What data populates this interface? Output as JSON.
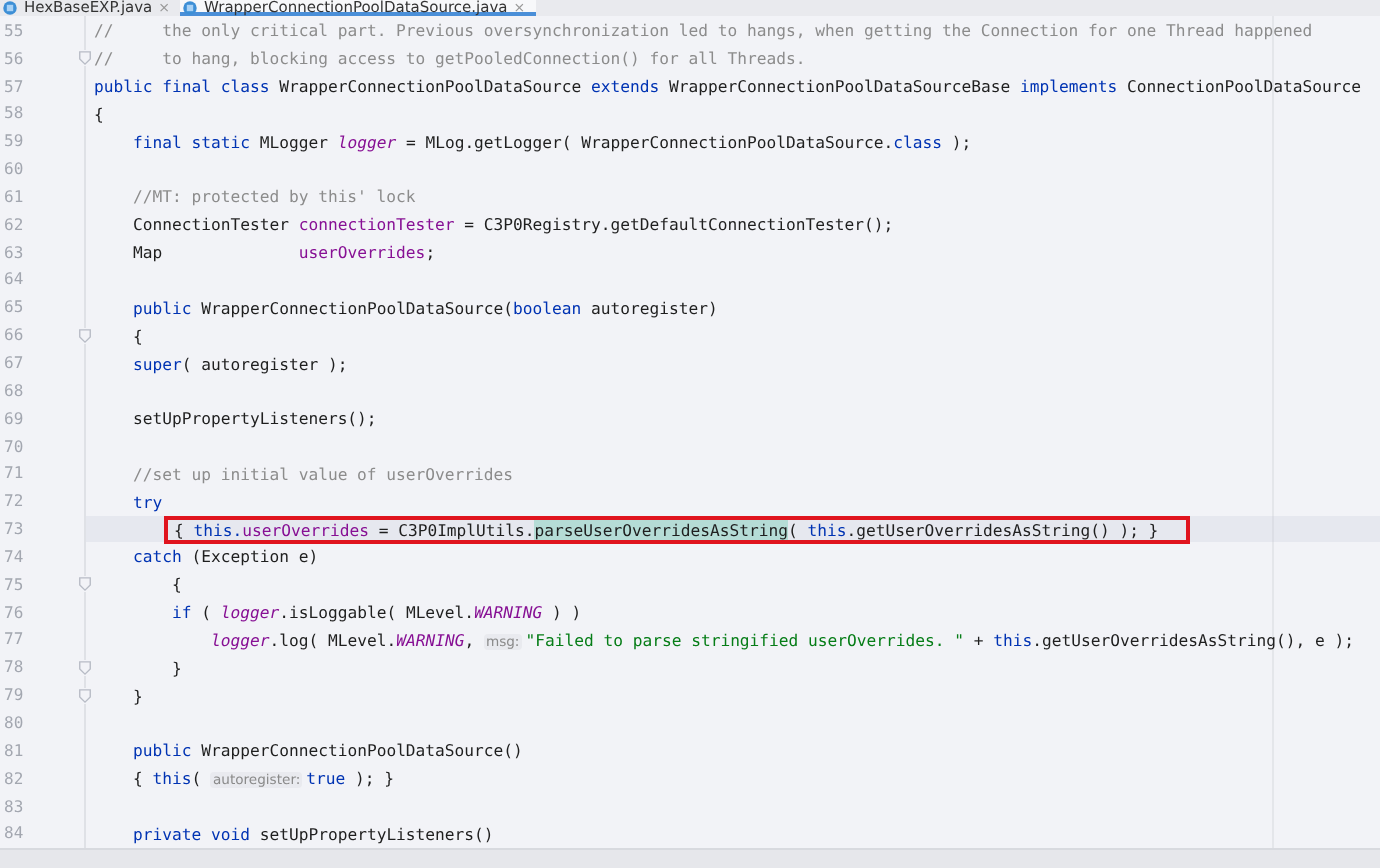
{
  "tabs": [
    {
      "label": "HexBaseEXP.java",
      "close": "×",
      "selected": false
    },
    {
      "label": "WrapperConnectionPoolDataSource.java",
      "close": "×",
      "selected": true
    }
  ],
  "lines": [
    {
      "number": "55",
      "tokens": [
        {
          "kind": "comment",
          "t": "//     the only critical part. Previous oversynchronization led to hangs, when getting the Connection for one Thread happened"
        }
      ]
    },
    {
      "number": "56",
      "fold": true,
      "tokens": [
        {
          "kind": "comment",
          "t": "//     to hang, blocking access to getPooledConnection() for all Threads."
        }
      ]
    },
    {
      "number": "57",
      "tokens": [
        {
          "kind": "keyword",
          "t": "public final class"
        },
        {
          "kind": "plain",
          "t": " WrapperConnectionPoolDataSource "
        },
        {
          "kind": "keyword",
          "t": "extends"
        },
        {
          "kind": "plain",
          "t": " WrapperConnectionPoolDataSourceBase "
        },
        {
          "kind": "keyword",
          "t": "implements"
        },
        {
          "kind": "plain",
          "t": " ConnectionPoolDataSource"
        }
      ]
    },
    {
      "number": "58",
      "tokens": [
        {
          "kind": "plain",
          "t": "{"
        }
      ]
    },
    {
      "number": "59",
      "tokens": [
        {
          "kind": "keyword",
          "t": "    final static"
        },
        {
          "kind": "plain",
          "t": " MLogger "
        },
        {
          "kind": "static",
          "t": "logger"
        },
        {
          "kind": "plain",
          "t": " = MLog.getLogger( WrapperConnectionPoolDataSource."
        },
        {
          "kind": "keyword",
          "t": "class"
        },
        {
          "kind": "plain",
          "t": " );"
        }
      ]
    },
    {
      "number": "60"
    },
    {
      "number": "61",
      "tokens": [
        {
          "kind": "comment",
          "t": "    //MT: protected by this' lock"
        }
      ]
    },
    {
      "number": "62",
      "tokens": [
        {
          "kind": "plain",
          "t": "    ConnectionTester "
        },
        {
          "kind": "field",
          "t": "connectionTester"
        },
        {
          "kind": "plain",
          "t": " = C3P0Registry.getDefaultConnectionTester();"
        }
      ]
    },
    {
      "number": "63",
      "tokens": [
        {
          "kind": "plain",
          "t": "    Map              "
        },
        {
          "kind": "field",
          "t": "userOverrides"
        },
        {
          "kind": "plain",
          "t": ";"
        }
      ]
    },
    {
      "number": "64"
    },
    {
      "number": "65",
      "tokens": [
        {
          "kind": "keyword",
          "t": "    public"
        },
        {
          "kind": "plain",
          "t": " WrapperConnectionPoolDataSource("
        },
        {
          "kind": "keyword",
          "t": "boolean"
        },
        {
          "kind": "plain",
          "t": " autoregister)"
        }
      ]
    },
    {
      "number": "66",
      "fold": true,
      "tokens": [
        {
          "kind": "plain",
          "t": "    {"
        }
      ]
    },
    {
      "number": "67",
      "tokens": [
        {
          "kind": "keyword",
          "t": "    super"
        },
        {
          "kind": "plain",
          "t": "( autoregister );"
        }
      ]
    },
    {
      "number": "68"
    },
    {
      "number": "69",
      "tokens": [
        {
          "kind": "plain",
          "t": "    setUpPropertyListeners();"
        }
      ]
    },
    {
      "number": "70"
    },
    {
      "number": "71",
      "tokens": [
        {
          "kind": "comment",
          "t": "    //set up initial value of userOverrides"
        }
      ]
    },
    {
      "number": "72",
      "tokens": [
        {
          "kind": "keyword",
          "t": "    try"
        }
      ]
    },
    {
      "number": "73",
      "current": true,
      "boxed": true,
      "tokens": [
        {
          "kind": "plain",
          "t": "        { "
        },
        {
          "kind": "keyword",
          "t": "this."
        },
        {
          "kind": "field",
          "t": "userOverrides"
        },
        {
          "kind": "plain",
          "t": " = C3P0ImplUtils."
        },
        {
          "kind": "match",
          "t": "parseUserOverridesAsString"
        },
        {
          "kind": "plain",
          "t": "( "
        },
        {
          "kind": "keyword",
          "t": "this"
        },
        {
          "kind": "plain",
          "t": ".getUserOverridesAsString() ); }"
        }
      ]
    },
    {
      "number": "74",
      "tokens": [
        {
          "kind": "keyword",
          "t": "    catch"
        },
        {
          "kind": "plain",
          "t": " (Exception e)"
        }
      ]
    },
    {
      "number": "75",
      "fold": true,
      "tokens": [
        {
          "kind": "plain",
          "t": "        {"
        }
      ]
    },
    {
      "number": "76",
      "tokens": [
        {
          "kind": "keyword",
          "t": "        if"
        },
        {
          "kind": "plain",
          "t": " ( "
        },
        {
          "kind": "static",
          "t": "logger"
        },
        {
          "kind": "plain",
          "t": ".isLoggable( MLevel."
        },
        {
          "kind": "static",
          "t": "WARNING"
        },
        {
          "kind": "plain",
          "t": " ) )"
        }
      ]
    },
    {
      "number": "77",
      "tokens": [
        {
          "kind": "static",
          "t": "            logger"
        },
        {
          "kind": "plain",
          "t": ".log( MLevel."
        },
        {
          "kind": "static",
          "t": "WARNING"
        },
        {
          "kind": "plain",
          "t": ", "
        },
        {
          "kind": "hint",
          "t": "msg:"
        },
        {
          "kind": "string",
          "t": "\"Failed to parse stringified userOverrides. \""
        },
        {
          "kind": "plain",
          "t": " + "
        },
        {
          "kind": "keyword",
          "t": "this"
        },
        {
          "kind": "plain",
          "t": ".getUserOverridesAsString(), e );"
        }
      ]
    },
    {
      "number": "78",
      "fold": true,
      "tokens": [
        {
          "kind": "plain",
          "t": "        }"
        }
      ]
    },
    {
      "number": "79",
      "fold": true,
      "tokens": [
        {
          "kind": "plain",
          "t": "    }"
        }
      ]
    },
    {
      "number": "80"
    },
    {
      "number": "81",
      "tokens": [
        {
          "kind": "keyword",
          "t": "    public"
        },
        {
          "kind": "plain",
          "t": " WrapperConnectionPoolDataSource()"
        }
      ]
    },
    {
      "number": "82",
      "tokens": [
        {
          "kind": "plain",
          "t": "    { "
        },
        {
          "kind": "keyword",
          "t": "this"
        },
        {
          "kind": "plain",
          "t": "( "
        },
        {
          "kind": "hint",
          "t": "autoregister:"
        },
        {
          "kind": "keyword",
          "t": "true"
        },
        {
          "kind": "plain",
          "t": " ); }"
        }
      ]
    },
    {
      "number": "83"
    },
    {
      "number": "84",
      "tokens": [
        {
          "kind": "keyword",
          "t": "    private void"
        },
        {
          "kind": "plain",
          "t": " setUpPropertyListeners()"
        }
      ]
    }
  ]
}
